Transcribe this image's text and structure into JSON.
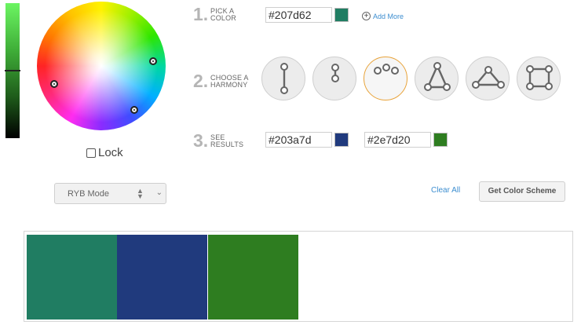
{
  "steps": {
    "pick": {
      "number": "1.",
      "label_line1": "PICK A",
      "label_line2": "COLOR"
    },
    "harmony": {
      "number": "2.",
      "label_line1": "CHOOSE A",
      "label_line2": "HARMONY"
    },
    "results": {
      "number": "3.",
      "label_line1": "SEE",
      "label_line2": "RESULTS"
    }
  },
  "base_color": {
    "hex": "#207d62",
    "color": "#207d62"
  },
  "add_more": {
    "label": "Add More"
  },
  "harmonies": [
    {
      "name": "complementary",
      "icon": "line-two-dots-icon",
      "selected": false
    },
    {
      "name": "split",
      "icon": "short-line-two-dots-icon",
      "selected": false
    },
    {
      "name": "analogous",
      "icon": "three-dots-arc-icon",
      "selected": true
    },
    {
      "name": "triad",
      "icon": "triangle-icon",
      "selected": false
    },
    {
      "name": "triad-wide",
      "icon": "wide-triangle-icon",
      "selected": false
    },
    {
      "name": "tetrad",
      "icon": "square-icon",
      "selected": false
    }
  ],
  "results": [
    {
      "hex": "#203a7d",
      "color": "#203a7d"
    },
    {
      "hex": "#2e7d20",
      "color": "#2e7d20"
    }
  ],
  "lock": {
    "label": "Lock",
    "checked": false
  },
  "mode_select": {
    "value": "RYB Mode"
  },
  "clear_all": {
    "label": "Clear All"
  },
  "scheme_button": {
    "label": "Get Color Scheme"
  },
  "palette": [
    {
      "color": "#207d62"
    },
    {
      "color": "#203a7d"
    },
    {
      "color": "#2e7d20"
    }
  ]
}
